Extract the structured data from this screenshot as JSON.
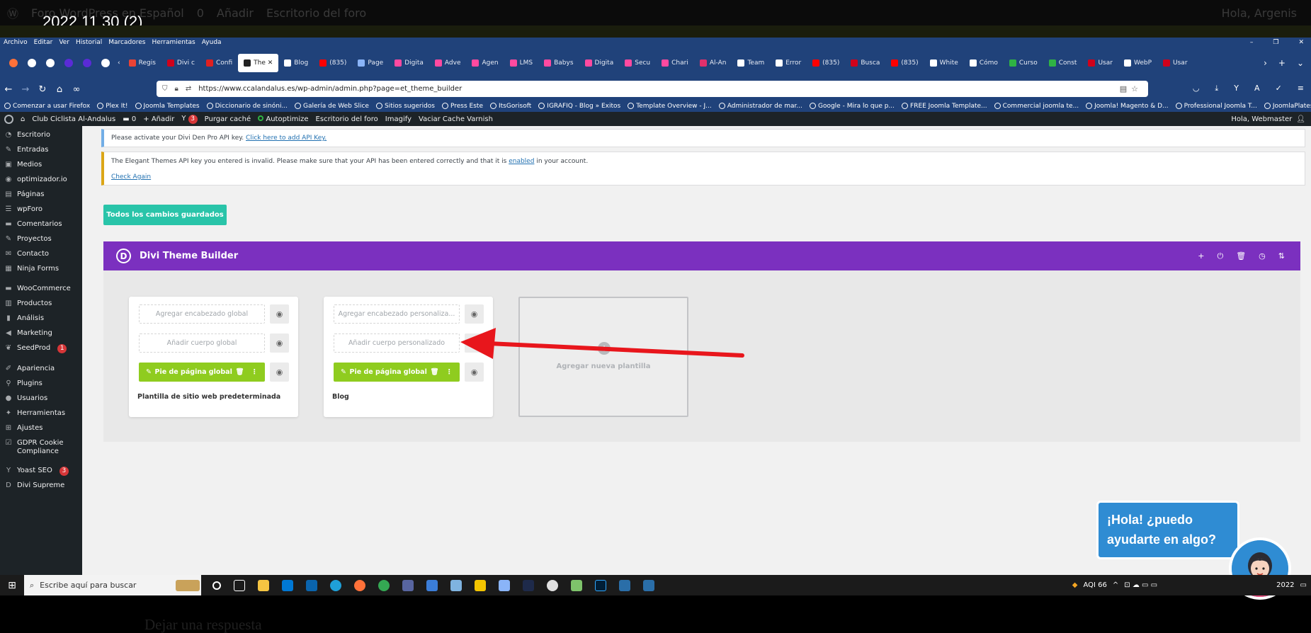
{
  "video": {
    "title": "2022 11 30 (2)",
    "bottom_text": "Dejar una respuesta"
  },
  "bg_wpbar": {
    "site": "Foro WordPress en Español",
    "comments": "0",
    "add": "Añadir",
    "forum": "Escritorio del foro",
    "greeting": "Hola, Argenis"
  },
  "menubar": {
    "items": [
      "Archivo",
      "Editar",
      "Ver",
      "Historial",
      "Marcadores",
      "Herramientas",
      "Ayuda"
    ]
  },
  "tabs": [
    {
      "label": "Regis",
      "color": "#ea4335"
    },
    {
      "label": "Divi c",
      "color": "#d0021b"
    },
    {
      "label": "Confi",
      "color": "#e02020"
    },
    {
      "label": "The ✕",
      "color": "#222222",
      "active": true
    },
    {
      "label": "Blog",
      "color": "#ffffff"
    },
    {
      "label": "(835)",
      "color": "#ff0000"
    },
    {
      "label": "Page",
      "color": "#8ab4f8"
    },
    {
      "label": "Digita",
      "color": "#ff4aa0"
    },
    {
      "label": "Adve",
      "color": "#ff4aa0"
    },
    {
      "label": "Agen",
      "color": "#ff4aa0"
    },
    {
      "label": "LMS",
      "color": "#ff4aa0"
    },
    {
      "label": "Babys",
      "color": "#ff4aa0"
    },
    {
      "label": "Digita",
      "color": "#ff4aa0"
    },
    {
      "label": "Secu",
      "color": "#ff4aa0"
    },
    {
      "label": "Chari",
      "color": "#ff4aa0"
    },
    {
      "label": "Al-An",
      "color": "#e1306c"
    },
    {
      "label": "Team",
      "color": "#ffffff"
    },
    {
      "label": "Error",
      "color": "#ffffff"
    },
    {
      "label": "(835)",
      "color": "#ff0000"
    },
    {
      "label": "Busca",
      "color": "#d0021b"
    },
    {
      "label": "(835)",
      "color": "#ff0000"
    },
    {
      "label": "White",
      "color": "#ffffff"
    },
    {
      "label": "Cómo",
      "color": "#ffffff"
    },
    {
      "label": "Curso",
      "color": "#2fb344"
    },
    {
      "label": "Const",
      "color": "#2fb344"
    },
    {
      "label": "Usar",
      "color": "#d0021b"
    },
    {
      "label": "WebP",
      "color": "#ffffff"
    },
    {
      "label": "Usar",
      "color": "#d0021b"
    }
  ],
  "url": "https://www.ccalandalus.es/wp-admin/admin.php?page=et_theme_builder",
  "bookmarks": [
    "Comenzar a usar Firefox",
    "Plex It!",
    "Joomla Templates",
    "Diccionario de sinóni...",
    "Galería de Web Slice",
    "Sitios sugeridos",
    "Press Este",
    "ItsGorisoft",
    "IGRAFIQ - Blog » Exitos",
    "Template Overview - J...",
    "Administrador de mar...",
    "Google - Mira lo que p...",
    "FREE Joomla Template...",
    "Commercial joomla te...",
    "Joomla! Magento & D...",
    "Professional Joomla T...",
    "JoomlaPlates.com :: D..."
  ],
  "wpadmin": {
    "site": "Club Ciclista Al-Andalus",
    "comments": "0",
    "add": "Añadir",
    "yoast_badge": "3",
    "purge": "Purgar caché",
    "autoptimize": "Autoptimize",
    "forum": "Escritorio del foro",
    "imagify": "Imagify",
    "varnish": "Vaciar Cache Varnish",
    "greeting": "Hola, Webmaster"
  },
  "sidebar": [
    {
      "label": "Escritorio",
      "icon": "dashboard-icon"
    },
    {
      "label": "Entradas",
      "icon": "pin-icon"
    },
    {
      "label": "Medios",
      "icon": "media-icon"
    },
    {
      "label": "optimizador.io",
      "icon": "optimizer-icon"
    },
    {
      "label": "Páginas",
      "icon": "page-icon"
    },
    {
      "label": "wpForo",
      "icon": "forum-icon"
    },
    {
      "label": "Comentarios",
      "icon": "comment-icon"
    },
    {
      "label": "Proyectos",
      "icon": "pin-icon"
    },
    {
      "label": "Contacto",
      "icon": "mail-icon"
    },
    {
      "label": "Ninja Forms",
      "icon": "form-icon"
    },
    {
      "label": "WooCommerce",
      "icon": "woo-icon"
    },
    {
      "label": "Productos",
      "icon": "box-icon"
    },
    {
      "label": "Análisis",
      "icon": "chart-icon"
    },
    {
      "label": "Marketing",
      "icon": "megaphone-icon"
    },
    {
      "label": "SeedProd",
      "icon": "seed-icon",
      "badge": "1"
    },
    {
      "label": "Apariencia",
      "icon": "brush-icon"
    },
    {
      "label": "Plugins",
      "icon": "plugin-icon"
    },
    {
      "label": "Usuarios",
      "icon": "user-icon"
    },
    {
      "label": "Herramientas",
      "icon": "wrench-icon"
    },
    {
      "label": "Ajustes",
      "icon": "settings-icon"
    },
    {
      "label": "GDPR Cookie Compliance",
      "icon": "check-icon"
    },
    {
      "label": "Yoast SEO",
      "icon": "yoast-icon",
      "badge": "3"
    },
    {
      "label": "Divi Supreme",
      "icon": "divi-icon"
    }
  ],
  "notices": {
    "n1_text": "Please activate your Divi Den Pro API key.",
    "n1_link": "Click here to add API Key.",
    "n2_pre": "The Elegant Themes API key you entered is invalid. Please make sure that your API has been entered correctly and that it is",
    "n2_link": "enabled",
    "n2_post": "in your account.",
    "n2_check": "Check Again"
  },
  "saved_button": "Todos los cambios guardados",
  "builder": {
    "logo": "D",
    "title": "Divi Theme Builder",
    "actions": [
      "+",
      "⏻",
      "🗑",
      "◷",
      "⇅"
    ],
    "cards": [
      {
        "header": "Agregar encabezado global",
        "body": "Añadir cuerpo global",
        "footer": "Pie de página global",
        "title": "Plantilla de sitio web predeterminada"
      },
      {
        "header": "Agregar encabezado personaliza...",
        "body": "Añadir cuerpo personalizado",
        "footer": "Pie de página global",
        "title": "Blog"
      }
    ],
    "add_label": "Agregar nueva plantilla",
    "add_plus": "+"
  },
  "chat": {
    "line1": "¡Hola! ¿puedo",
    "line2": "ayudarte en algo?"
  },
  "taskbar": {
    "search": "Escribe aquí para buscar",
    "aqi": "AQI 66",
    "year": "2022"
  },
  "colors": {
    "divi_purple": "#7b30bf",
    "saved_teal": "#29c4a9",
    "footer_green": "#8fcc1f",
    "arrow_red": "#e8161c",
    "wp_dark": "#1d2327",
    "firefox_blue": "#20427a"
  }
}
